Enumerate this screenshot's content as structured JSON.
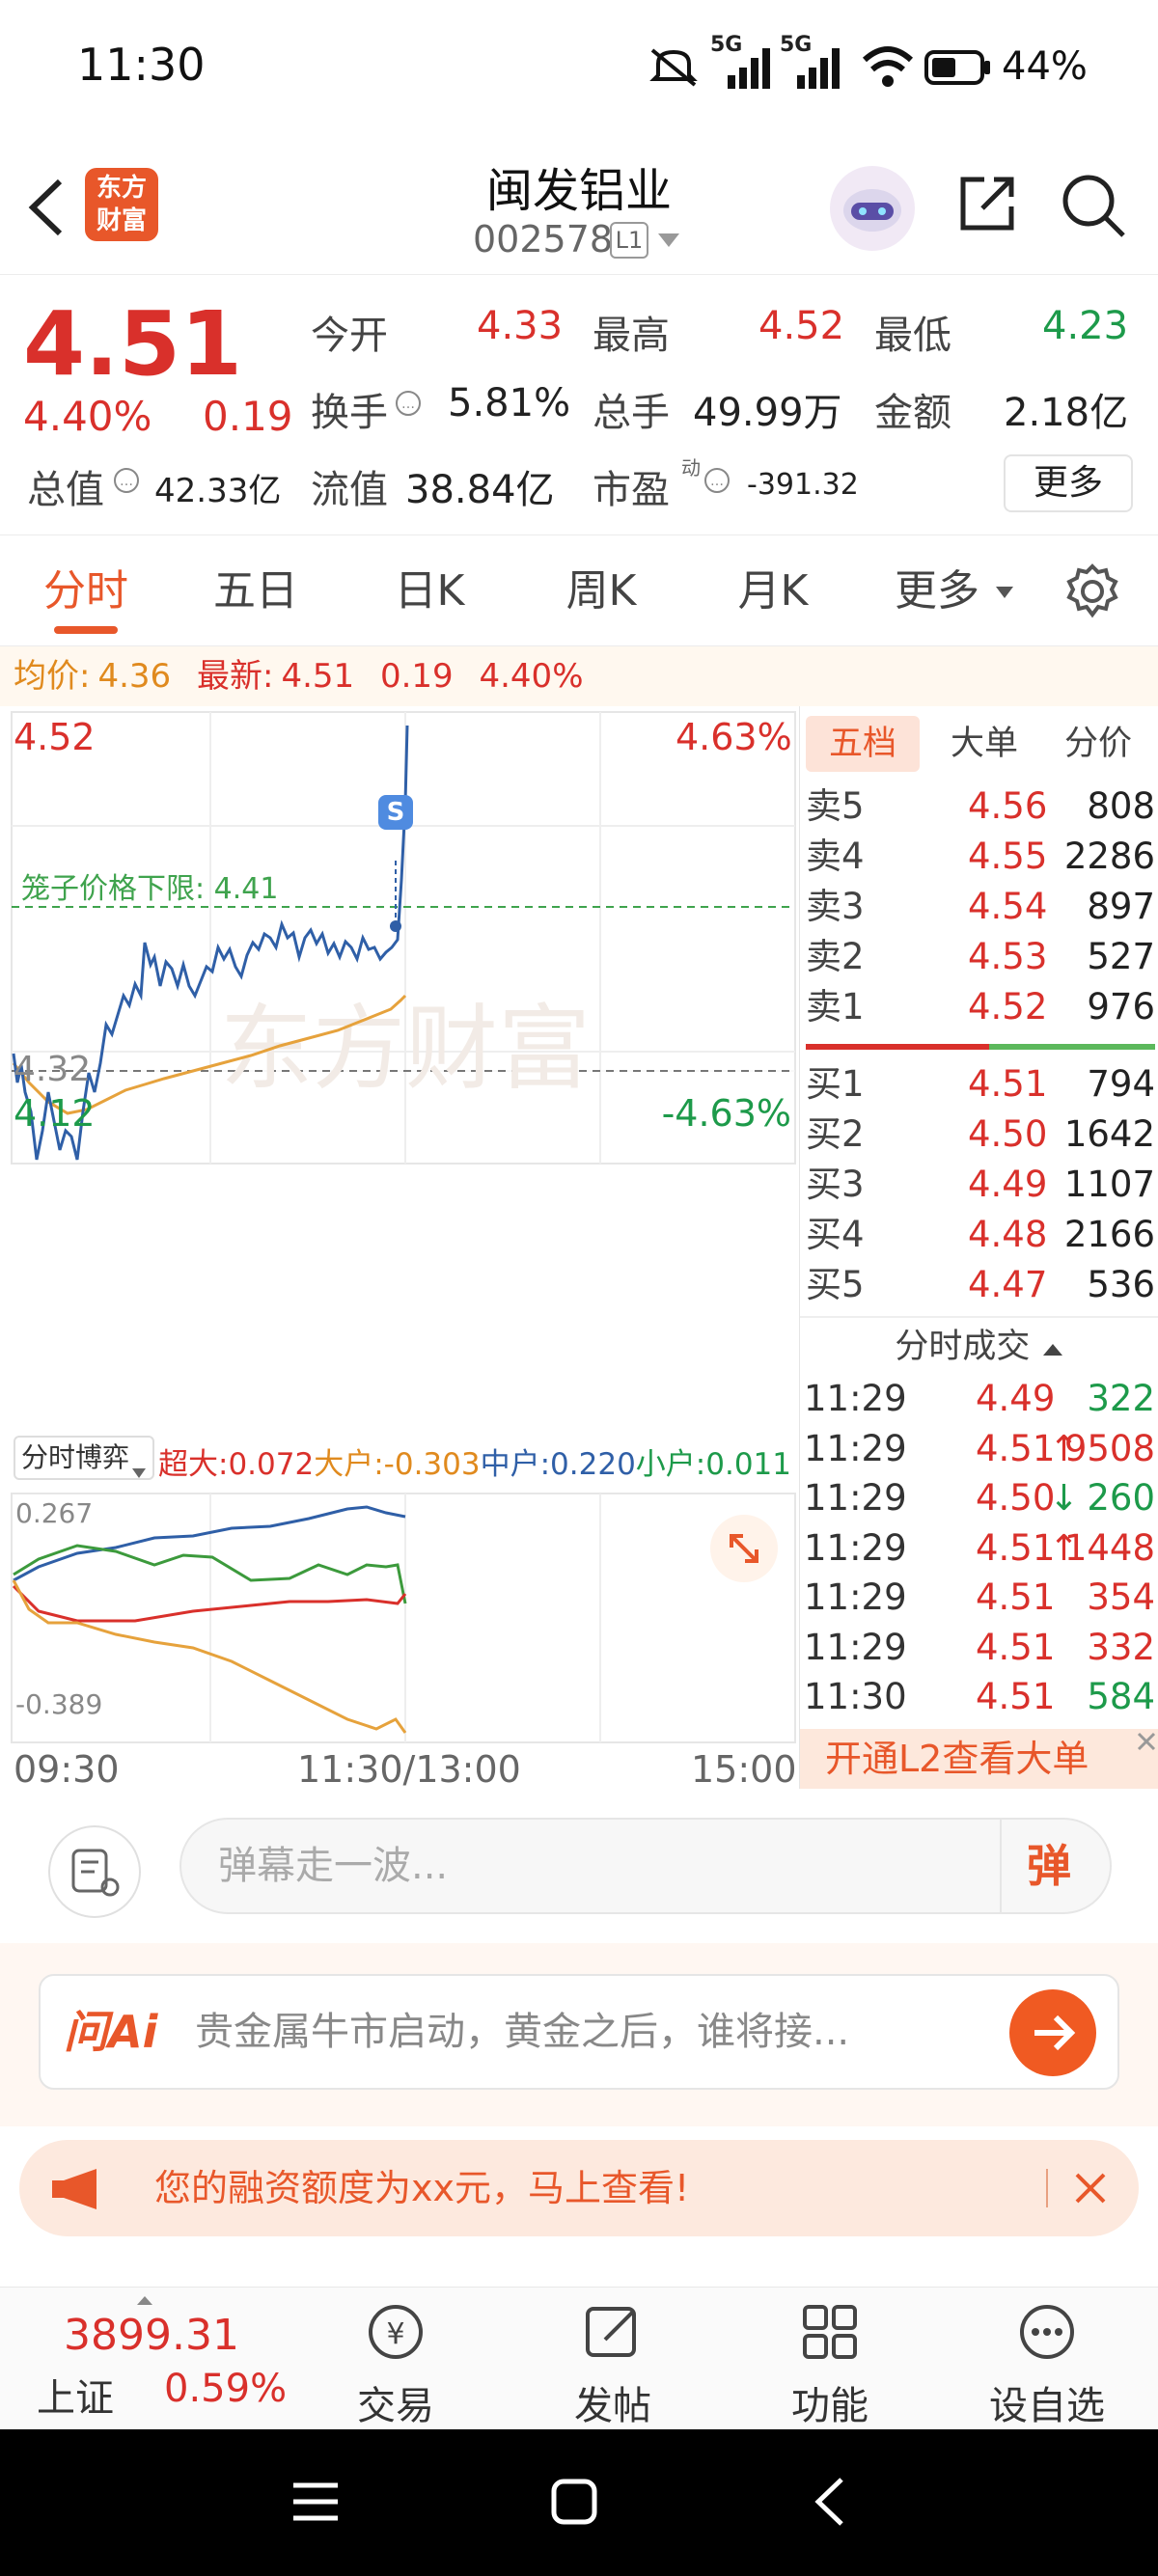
{
  "status": {
    "time": "11:30",
    "network1": "5G",
    "network2": "5G",
    "battery": "44%"
  },
  "header": {
    "title": "闽发铝业",
    "code": "002578",
    "level": "L1",
    "logo_line1": "东方",
    "logo_line2": "财富"
  },
  "quote": {
    "price": "4.51",
    "change_pct": "4.40%",
    "change": "0.19",
    "open_label": "今开",
    "open": "4.33",
    "high_label": "最高",
    "high": "4.52",
    "low_label": "最低",
    "low": "4.23",
    "turnover_label": "换手",
    "turnover": "5.81%",
    "volume_label": "总手",
    "volume": "49.99万",
    "amount_label": "金额",
    "amount": "2.18亿",
    "mcap_label": "总值",
    "mcap": "42.33亿",
    "float_label": "流值",
    "float": "38.84亿",
    "pe_label": "市盈",
    "pe_sup": "动",
    "pe": "-391.32",
    "more": "更多"
  },
  "tabs": [
    "分时",
    "五日",
    "日K",
    "周K",
    "月K",
    "更多"
  ],
  "avg_line": {
    "avg_label": "均价:",
    "avg": "4.36",
    "latest_label": "最新:",
    "latest": "4.51",
    "change": "0.19",
    "pct": "4.40%"
  },
  "chart": {
    "top_price": "4.52",
    "top_pct": "4.63%",
    "bottom_price": "4.12",
    "bottom_pct": "-4.63%",
    "mid_price": "4.32",
    "cage_label": "笼子价格下限: 4.41",
    "watermark": "东方财富",
    "flow_selector": "分时博弈",
    "flow_super_label": "超大:",
    "flow_super": "0.072",
    "flow_big_label": "大户:",
    "flow_big": "-0.303",
    "flow_mid_label": "中户:",
    "flow_mid": "0.220",
    "flow_small_label": "小户:",
    "flow_small": "0.011",
    "flow_top": "0.267",
    "flow_bottom": "-0.389",
    "t_start": "09:30",
    "t_mid": "11:30/13:00",
    "t_end": "15:00",
    "s_badge": "S"
  },
  "book": {
    "tabs": [
      "五档",
      "大单",
      "分价"
    ],
    "asks": [
      {
        "label": "卖5",
        "price": "4.56",
        "vol": "808"
      },
      {
        "label": "卖4",
        "price": "4.55",
        "vol": "2286"
      },
      {
        "label": "卖3",
        "price": "4.54",
        "vol": "897"
      },
      {
        "label": "卖2",
        "price": "4.53",
        "vol": "527"
      },
      {
        "label": "卖1",
        "price": "4.52",
        "vol": "976"
      }
    ],
    "bids": [
      {
        "label": "买1",
        "price": "4.51",
        "vol": "794"
      },
      {
        "label": "买2",
        "price": "4.50",
        "vol": "1642"
      },
      {
        "label": "买3",
        "price": "4.49",
        "vol": "1107"
      },
      {
        "label": "买4",
        "price": "4.48",
        "vol": "2166"
      },
      {
        "label": "买5",
        "price": "4.47",
        "vol": "536"
      }
    ],
    "ticks_title": "分时成交",
    "ticks": [
      {
        "time": "11:29",
        "price": "4.49",
        "dir": "",
        "vol": "322",
        "color": "green"
      },
      {
        "time": "11:29",
        "price": "4.51",
        "dir": "↑",
        "vol": "9508",
        "color": "red"
      },
      {
        "time": "11:29",
        "price": "4.50",
        "dir": "↓",
        "vol": "260",
        "color": "green"
      },
      {
        "time": "11:29",
        "price": "4.51",
        "dir": "↑",
        "vol": "1448",
        "color": "red"
      },
      {
        "time": "11:29",
        "price": "4.51",
        "dir": "",
        "vol": "354",
        "color": "red"
      },
      {
        "time": "11:29",
        "price": "4.51",
        "dir": "",
        "vol": "332",
        "color": "red"
      },
      {
        "time": "11:30",
        "price": "4.51",
        "dir": "",
        "vol": "584",
        "color": "green"
      }
    ],
    "l2_banner": "开通L2查看大单"
  },
  "danmu": {
    "placeholder": "弹幕走一波...",
    "send": "弹"
  },
  "ai": {
    "label": "问Ai",
    "text": "贵金属牛市启动，黄金之后，谁将接..."
  },
  "promo": {
    "text": "您的融资额度为xx元，马上查看!"
  },
  "bottom_nav": {
    "index_value": "3899.31",
    "index_name": "上证",
    "index_pct": "0.59%",
    "items": [
      "交易",
      "发帖",
      "功能",
      "设自选"
    ]
  },
  "colors": {
    "up": "#d9302b",
    "down": "#1d9a4a",
    "accent": "#e8572a",
    "avg": "#e6a23c",
    "price_line": "#2f5fa7"
  }
}
